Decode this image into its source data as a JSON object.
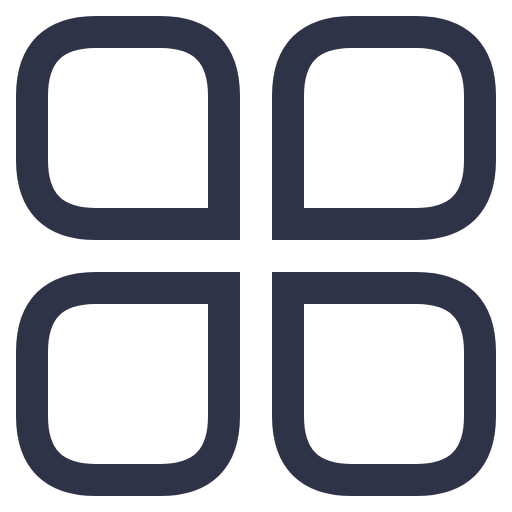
{
  "icon": {
    "name": "four-rounded-squares-menu-icon",
    "stroke_color": "#2f3348",
    "background_color": "#ffffff"
  }
}
